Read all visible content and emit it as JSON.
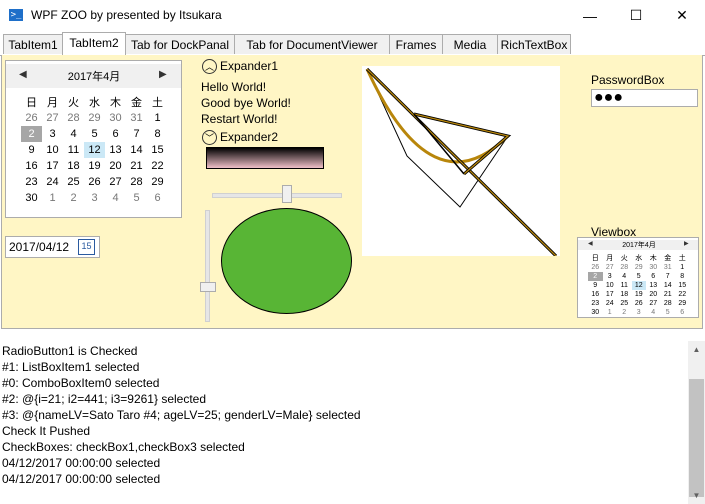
{
  "window": {
    "title": "WPF ZOO by presented by Itsukara",
    "app_icon": ">_",
    "minimize_icon": "—",
    "maximize_icon": "☐",
    "close_icon": "✕"
  },
  "tabs": [
    {
      "label": "TabItem1"
    },
    {
      "label": "TabItem2"
    },
    {
      "label": "Tab for DockPanal"
    },
    {
      "label": "Tab for DocumentViewer"
    },
    {
      "label": "Frames"
    },
    {
      "label": "Media"
    },
    {
      "label": "RichTextBox"
    }
  ],
  "active_tab": "TabItem2",
  "calendar": {
    "prev": "◀",
    "next": "▶",
    "month_label": "2017年4月",
    "weekdays": [
      "日",
      "月",
      "火",
      "水",
      "木",
      "金",
      "土"
    ],
    "weeks": [
      [
        "26",
        "27",
        "28",
        "29",
        "30",
        "31",
        "1"
      ],
      [
        "2",
        "3",
        "4",
        "5",
        "6",
        "7",
        "8"
      ],
      [
        "9",
        "10",
        "11",
        "12",
        "13",
        "14",
        "15"
      ],
      [
        "16",
        "17",
        "18",
        "19",
        "20",
        "21",
        "22"
      ],
      [
        "23",
        "24",
        "25",
        "26",
        "27",
        "28",
        "29"
      ],
      [
        "30",
        "1",
        "2",
        "3",
        "4",
        "5",
        "6"
      ]
    ],
    "today": "2",
    "selected": "12"
  },
  "datepicker": {
    "value": "2017/04/12",
    "icon_text": "15"
  },
  "expander1": {
    "header": "Expander1",
    "icon": "︿",
    "lines": [
      "Hello World!",
      "Good bye World!",
      "Restart World!"
    ]
  },
  "expander2": {
    "header": "Expander2",
    "icon": "﹀"
  },
  "password": {
    "label": "PasswordBox",
    "value": "●●●"
  },
  "viewbox": {
    "label": "Viewbox"
  },
  "log_lines": [
    "RadioButton1 is Checked",
    "#1: ListBoxItem1 selected",
    "#0: ComboBoxItem0 selected",
    "#2: @{i=21; i2=441; i3=9261} selected",
    "#3: @{nameLV=Sato Taro #4; ageLV=25; genderLV=Male} selected",
    "Check It Pushed",
    "CheckBoxes: checkBox1,checkBox3 selected",
    "04/12/2017 00:00:00 selected",
    "04/12/2017 00:00:00 selected"
  ],
  "scrollbar": {
    "up": "▲",
    "down": "▼"
  },
  "colors": {
    "content_bg": "#fff6c5",
    "ellipse_fill": "#58b535",
    "curve": "#b8860b"
  }
}
